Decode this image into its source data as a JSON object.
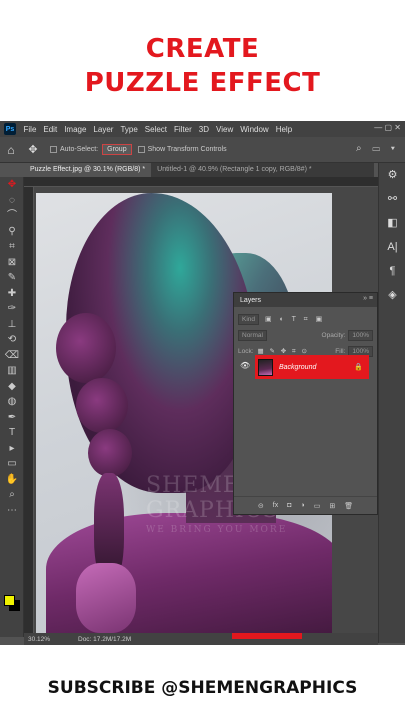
{
  "headline": {
    "line1": "CREATE",
    "line2": "PUZZLE EFFECT"
  },
  "footer": "SUBSCRIBE @SHEMENGRAPHICS",
  "app": {
    "logo": "Ps",
    "menu": [
      "File",
      "Edit",
      "Image",
      "Layer",
      "Type",
      "Select",
      "Filter",
      "3D",
      "View",
      "Window",
      "Help"
    ],
    "window_controls": "—  ▢  ✕"
  },
  "options": {
    "auto_select_label": "Auto-Select:",
    "auto_select_value": "Group",
    "transform_label": "Show Transform Controls",
    "right_icons": "⌕ ▭ ▾"
  },
  "tabs": [
    {
      "label": "Puzzle Effect.jpg @ 30.1% (RGB/8) *",
      "active": true
    },
    {
      "label": "Untitled-1 @ 40.9% (Rectangle 1 copy, RGB/8#) *",
      "active": false
    }
  ],
  "tools": [
    "✥",
    "◌",
    "⌒",
    "⚲",
    "⌗",
    "⊠",
    "✎",
    "✚",
    "✑",
    "⊥",
    "⟲",
    "⌫",
    "▥",
    "◆",
    "◍",
    "✒",
    "T",
    "▸",
    "▭",
    "✋",
    "⌕",
    "⋯"
  ],
  "dock_icons": [
    "⚙",
    "⚯",
    "◧",
    "A|",
    "¶",
    "◈"
  ],
  "status": {
    "zoom": "30.12%",
    "doc": "Doc: 17.2M/17.2M"
  },
  "watermark": {
    "title": "SHEMEN GRAPHICS",
    "tagline": "WE BRING YOU MORE"
  },
  "layers_panel": {
    "title": "Layers",
    "header_controls": "»  ≡",
    "kind_label": "Kind",
    "filter_icons": "▣ ◐ T ⌗ ▣",
    "blend_mode": "Normal",
    "opacity_label": "Opacity:",
    "opacity_value": "100%",
    "lock_label": "Lock:",
    "lock_icons": "▦ ✎ ✥ ⌗ ⊙",
    "fill_label": "Fill:",
    "fill_value": "100%",
    "layers": [
      {
        "name": "Background",
        "visible": true,
        "locked": true
      }
    ],
    "footer_icons": [
      "⊝",
      "fx",
      "◘",
      "◑",
      "▭",
      "⊞",
      "🗑"
    ]
  },
  "colors": {
    "accent": "#e3181e",
    "foreground_swatch": "#f0f200",
    "background_swatch": "#000000"
  }
}
